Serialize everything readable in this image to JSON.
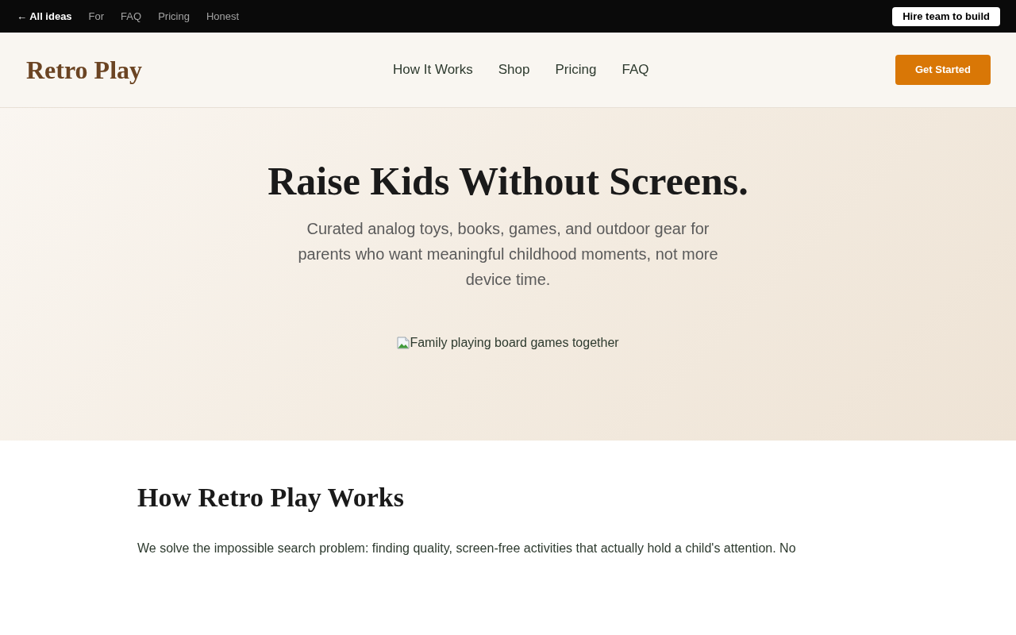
{
  "top_bar": {
    "back_link": "← All ideas",
    "links": [
      "For",
      "FAQ",
      "Pricing",
      "Honest"
    ],
    "cta": "Hire team to build"
  },
  "header": {
    "logo": "Retro Play",
    "nav": [
      "How It Works",
      "Shop",
      "Pricing",
      "FAQ"
    ],
    "cta": "Get Started"
  },
  "hero": {
    "title": "Raise Kids Without Screens.",
    "subtitle": "Curated analog toys, books, games, and outdoor gear for parents who want meaningful childhood moments, not more device time.",
    "image_alt": "Family playing board games together"
  },
  "how_it_works": {
    "title": "How Retro Play Works",
    "body": "We solve the impossible search problem: finding quality, screen-free activities that actually hold a child's attention. No"
  }
}
